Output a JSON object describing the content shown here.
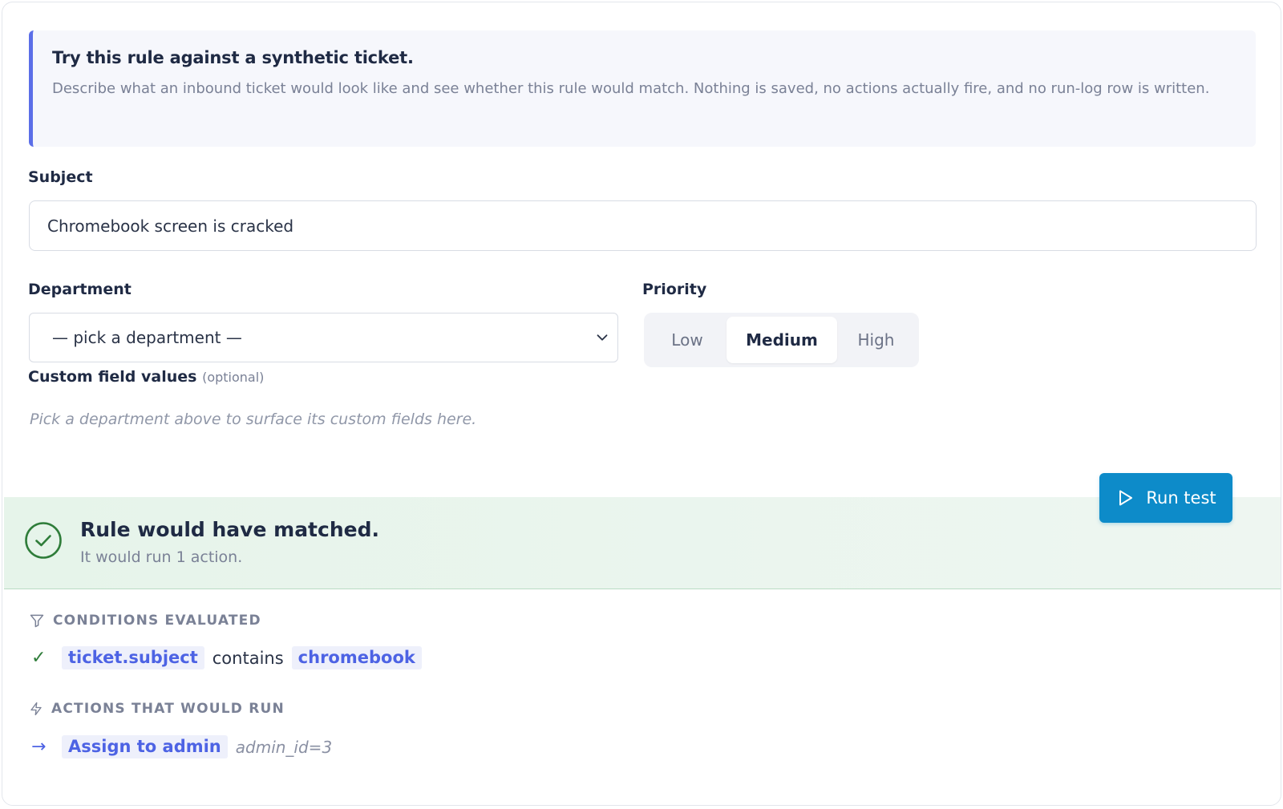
{
  "intro": {
    "title": "Try this rule against a synthetic ticket.",
    "description": "Describe what an inbound ticket would look like and see whether this rule would match. Nothing is saved, no actions actually fire, and no run-log row is written."
  },
  "subject": {
    "label": "Subject",
    "value": "Chromebook screen is cracked"
  },
  "department": {
    "label": "Department",
    "selected": "— pick a department —"
  },
  "priority": {
    "label": "Priority",
    "options": [
      "Low",
      "Medium",
      "High"
    ],
    "selected": "Medium"
  },
  "custom_fields": {
    "label": "Custom field values",
    "optional": "(optional)",
    "hint": "Pick a department above to surface its custom fields here."
  },
  "run_button": {
    "label": "Run test"
  },
  "result": {
    "title": "Rule would have matched.",
    "subtitle": "It would run 1 action."
  },
  "conditions": {
    "heading": "CONDITIONS EVALUATED",
    "items": [
      {
        "field": "ticket.subject",
        "operator": "contains",
        "value": "chromebook",
        "passed": "✓"
      }
    ]
  },
  "actions": {
    "heading": "ACTIONS THAT WOULD RUN",
    "items": [
      {
        "arrow": "→",
        "name": "Assign to admin",
        "params": "admin_id=3"
      }
    ]
  },
  "colors": {
    "accent": "#5b6ee8",
    "button": "#0d8bc9",
    "success": "#2f7d3a",
    "chip_text": "#4d63e4"
  }
}
